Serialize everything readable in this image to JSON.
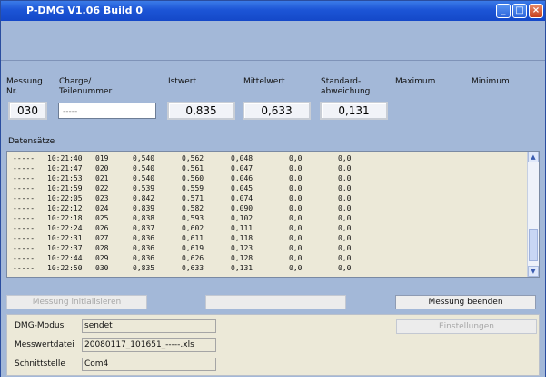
{
  "window": {
    "title": "P-DMG V1.06 Build 0",
    "minimize": "_",
    "maximize": "□",
    "close": "×"
  },
  "headers": {
    "messung": "Messung\nNr.",
    "charge": "Charge/\nTeilenummer",
    "istwert": "Istwert",
    "mittelwert": "Mittelwert",
    "standardabweichung": "Standard-\nabweichung",
    "maximum": "Maximum",
    "minimum": "Minimum"
  },
  "values": {
    "messung_nr": "030",
    "charge": "-----",
    "istwert": "0,835",
    "mittelwert": "0,633",
    "standardabweichung": "0,131"
  },
  "datensaetze_label": "Datensätze",
  "log_rows": [
    [
      "-----",
      "10:21:40",
      "019",
      "0,540",
      "0,562",
      "0,048",
      "0,0",
      "0,0"
    ],
    [
      "-----",
      "10:21:47",
      "020",
      "0,540",
      "0,561",
      "0,047",
      "0,0",
      "0,0"
    ],
    [
      "-----",
      "10:21:53",
      "021",
      "0,540",
      "0,560",
      "0,046",
      "0,0",
      "0,0"
    ],
    [
      "-----",
      "10:21:59",
      "022",
      "0,539",
      "0,559",
      "0,045",
      "0,0",
      "0,0"
    ],
    [
      "-----",
      "10:22:05",
      "023",
      "0,842",
      "0,571",
      "0,074",
      "0,0",
      "0,0"
    ],
    [
      "-----",
      "10:22:12",
      "024",
      "0,839",
      "0,582",
      "0,090",
      "0,0",
      "0,0"
    ],
    [
      "-----",
      "10:22:18",
      "025",
      "0,838",
      "0,593",
      "0,102",
      "0,0",
      "0,0"
    ],
    [
      "-----",
      "10:22:24",
      "026",
      "0,837",
      "0,602",
      "0,111",
      "0,0",
      "0,0"
    ],
    [
      "-----",
      "10:22:31",
      "027",
      "0,836",
      "0,611",
      "0,118",
      "0,0",
      "0,0"
    ],
    [
      "-----",
      "10:22:37",
      "028",
      "0,836",
      "0,619",
      "0,123",
      "0,0",
      "0,0"
    ],
    [
      "-----",
      "10:22:44",
      "029",
      "0,836",
      "0,626",
      "0,128",
      "0,0",
      "0,0"
    ],
    [
      "-----",
      "10:22:50",
      "030",
      "0,835",
      "0,633",
      "0,131",
      "0,0",
      "0,0"
    ]
  ],
  "buttons": {
    "messung_initialisieren": "Messung initialisieren",
    "middle": "",
    "messung_beenden": "Messung beenden",
    "einstellungen": "Einstellungen"
  },
  "status": {
    "dmg_modus_label": "DMG-Modus",
    "dmg_modus_value": "sendet",
    "messwertdatei_label": "Messwertdatei",
    "messwertdatei_value": "20080117_101651_-----.xls",
    "schnittstelle_label": "Schnittstelle",
    "schnittstelle_value": "Com4"
  },
  "colors": {
    "titlebar": "#1c55d6",
    "window_bg": "#a3b8d8",
    "panel_bg": "#ece9d8"
  }
}
